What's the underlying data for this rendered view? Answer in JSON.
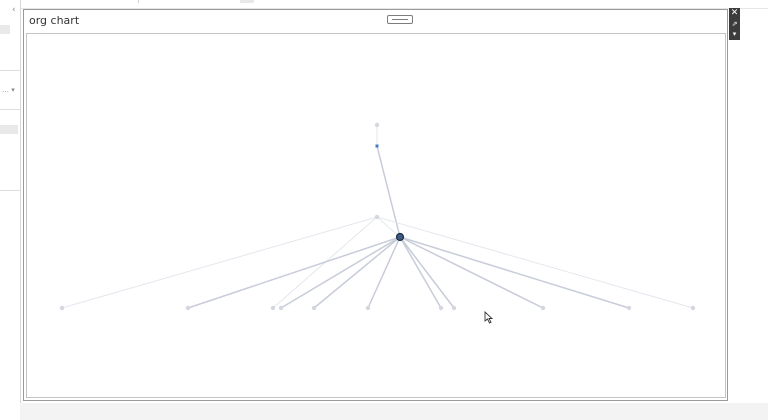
{
  "modal": {
    "title": "org chart"
  },
  "toolbar": {
    "close_glyph": "✕",
    "popout_glyph": "⇗",
    "menu_glyph": "▾"
  },
  "left_panel": {
    "collapse_glyph": "‹",
    "dropdown_glyph": "… ▾"
  },
  "colors": {
    "edge_active": "#c7ccd9",
    "edge_faded": "#e4e7ee",
    "node_faded": "#d4d7de",
    "node_selected_fill": "#3d5a80",
    "node_selected_stroke": "#1e2d45",
    "node_small_blue": "#4a78c2"
  },
  "graph": {
    "nodes": [
      {
        "id": "n_top_faint",
        "state": "faded"
      },
      {
        "id": "n_top_blue",
        "state": "small-blue"
      },
      {
        "id": "n_mid",
        "state": "faded"
      },
      {
        "id": "n_center",
        "state": "selected"
      },
      {
        "id": "leaf_1",
        "state": "faded"
      },
      {
        "id": "leaf_2",
        "state": "faded"
      },
      {
        "id": "leaf_3",
        "state": "faded"
      },
      {
        "id": "leaf_4",
        "state": "faded"
      },
      {
        "id": "leaf_5",
        "state": "faded"
      },
      {
        "id": "leaf_6",
        "state": "faded"
      },
      {
        "id": "leaf_7",
        "state": "faded"
      },
      {
        "id": "leaf_8",
        "state": "faded"
      },
      {
        "id": "leaf_9",
        "state": "faded"
      },
      {
        "id": "leaf_10",
        "state": "faded"
      },
      {
        "id": "leaf_11",
        "state": "faded"
      }
    ],
    "edges": [
      {
        "from": "n_top_faint",
        "to": "n_top_blue",
        "state": "faded"
      },
      {
        "from": "n_top_blue",
        "to": "n_center",
        "state": "active"
      },
      {
        "from": "n_mid",
        "to": "n_center",
        "state": "faded"
      },
      {
        "from": "n_mid",
        "to": "leaf_1",
        "state": "faded"
      },
      {
        "from": "n_mid",
        "to": "leaf_3",
        "state": "faded"
      },
      {
        "from": "n_mid",
        "to": "leaf_11",
        "state": "faded"
      },
      {
        "from": "n_center",
        "to": "leaf_2",
        "state": "active"
      },
      {
        "from": "n_center",
        "to": "leaf_4",
        "state": "active"
      },
      {
        "from": "n_center",
        "to": "leaf_5",
        "state": "active"
      },
      {
        "from": "n_center",
        "to": "leaf_6",
        "state": "active"
      },
      {
        "from": "n_center",
        "to": "leaf_7",
        "state": "active"
      },
      {
        "from": "n_center",
        "to": "leaf_8",
        "state": "active"
      },
      {
        "from": "n_center",
        "to": "leaf_9",
        "state": "active"
      },
      {
        "from": "n_center",
        "to": "leaf_10",
        "state": "active"
      }
    ]
  }
}
